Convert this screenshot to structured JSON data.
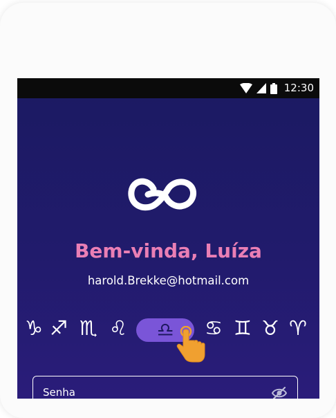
{
  "status_bar": {
    "time": "12:30",
    "icons": [
      "wifi-icon",
      "cellular-signal-icon",
      "battery-icon"
    ]
  },
  "logo": {
    "icon": "brand-logo-icon"
  },
  "welcome": {
    "title": "Bem-vinda, Luíza",
    "email": "harold.Brekke@hotmail.com"
  },
  "zodiac": {
    "signs": [
      {
        "name": "capricorn",
        "glyph": "♑"
      },
      {
        "name": "sagittarius",
        "glyph": "♐"
      },
      {
        "name": "scorpio",
        "glyph": "♏"
      },
      {
        "name": "leo",
        "glyph": "♌"
      },
      {
        "name": "libra",
        "glyph": "♎"
      },
      {
        "name": "cancer",
        "glyph": "♋"
      },
      {
        "name": "gemini",
        "glyph": "♊"
      },
      {
        "name": "taurus",
        "glyph": "♉"
      },
      {
        "name": "aries",
        "glyph": "♈"
      }
    ],
    "selected": "libra",
    "pointer_icon": "hand-pointer-icon"
  },
  "password": {
    "label": "Senha",
    "toggle_icon": "eye-off-icon"
  },
  "colors": {
    "background_top": "#1b1a62",
    "background_bottom": "#2a1c7a",
    "title": "#ea7fb5",
    "selected_chip": "#7a55d8",
    "hand": "#f0a030"
  }
}
